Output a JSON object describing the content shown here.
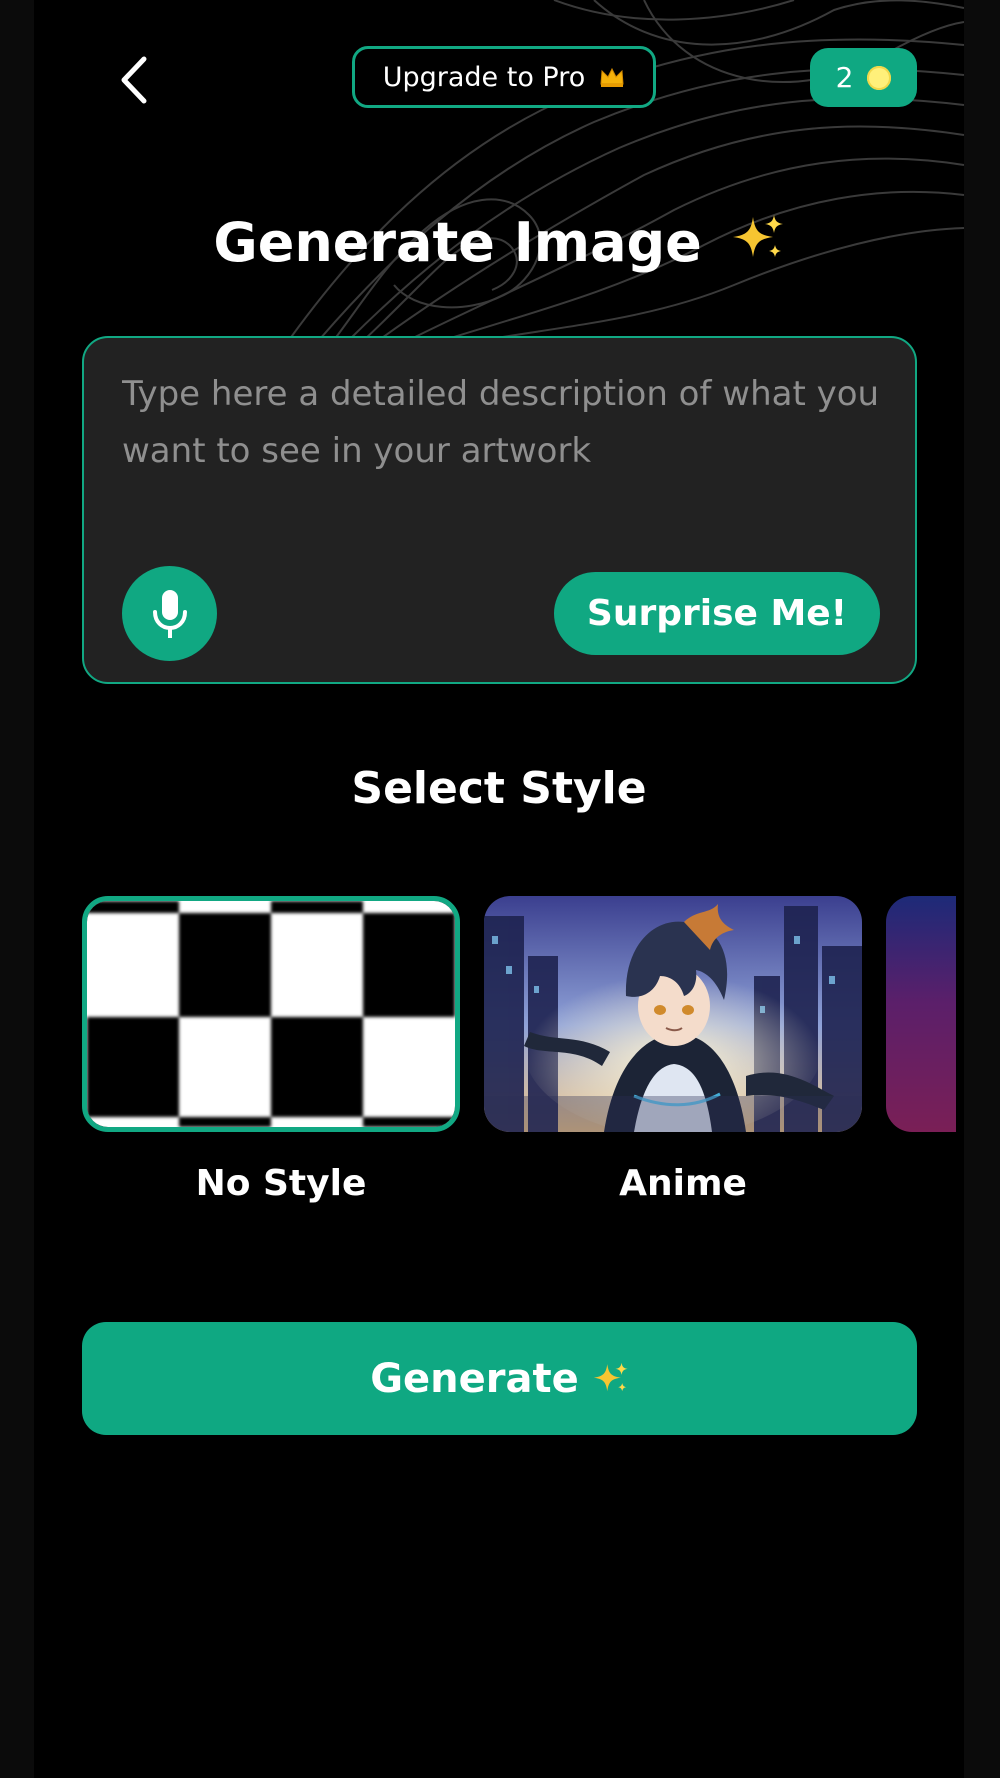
{
  "header": {
    "back_icon": "chevron-left-icon",
    "upgrade_label": "Upgrade to Pro",
    "upgrade_icon": "crown-icon",
    "credits_count": "2",
    "credits_icon": "coin-icon"
  },
  "title": {
    "text": "Generate Image",
    "icon": "sparkles-icon"
  },
  "prompt": {
    "value": "",
    "placeholder": "Type here a detailed description of what you want to see in your artwork",
    "mic_icon": "microphone-icon",
    "surprise_label": "Surprise Me!"
  },
  "styles": {
    "title": "Select Style",
    "items": [
      {
        "label": "No Style",
        "selected": true
      },
      {
        "label": "Anime",
        "selected": false
      }
    ]
  },
  "generate": {
    "label": "Generate",
    "icon": "sparkles-icon"
  },
  "colors": {
    "accent": "#10A882",
    "background": "#000000",
    "input_background": "#222222",
    "placeholder": "#8F8F8F"
  }
}
